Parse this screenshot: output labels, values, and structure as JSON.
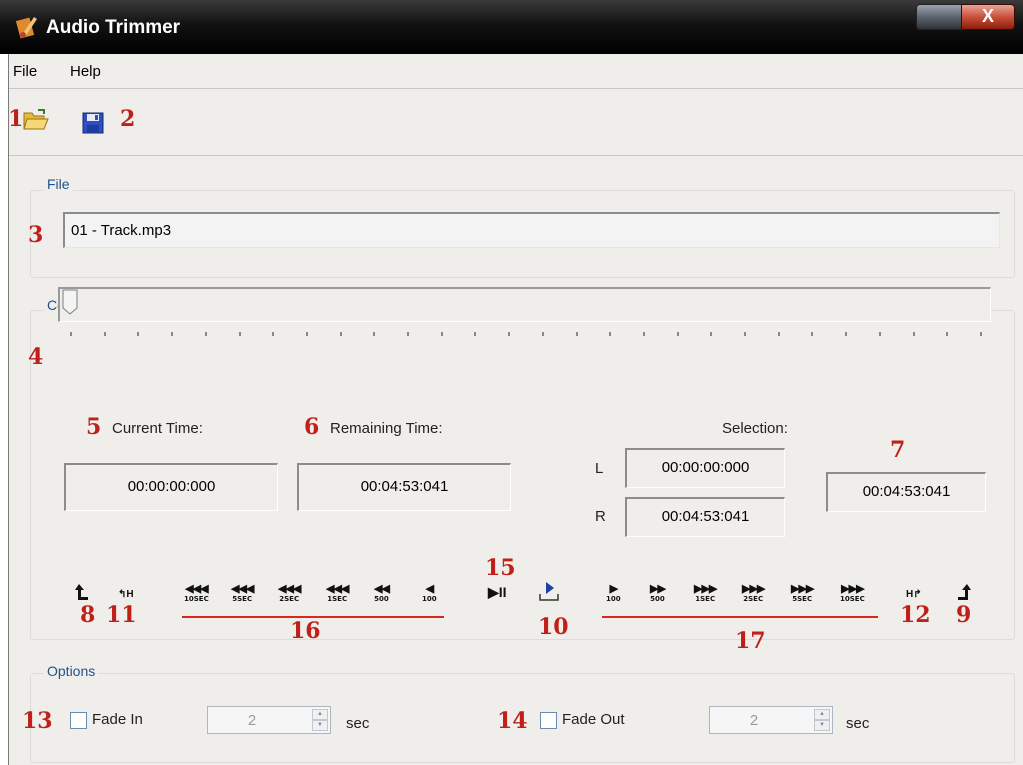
{
  "window": {
    "title": "Audio Trimmer",
    "close_glyph": "X"
  },
  "menu": {
    "file": "File",
    "help": "Help"
  },
  "toolbar": {
    "open_icon": "folder-open-icon",
    "save_icon": "floppy-save-icon"
  },
  "callouts": {
    "n1": "1",
    "n2": "2",
    "n3": "3",
    "n4": "4",
    "n5": "5",
    "n6": "6",
    "n7": "7",
    "n8": "8",
    "n9": "9",
    "n10": "10",
    "n11": "11",
    "n12": "12",
    "n13": "13",
    "n14": "14",
    "n15": "15",
    "n16": "16",
    "n17": "17"
  },
  "file_group": {
    "label": "File",
    "path": "01 - Track.mp3"
  },
  "control_group": {
    "label": "Control",
    "slider_position": 0,
    "current_time_label": "Current Time:",
    "current_time": "00:00:00:000",
    "remaining_time_label": "Remaining Time:",
    "remaining_time": "00:04:53:041",
    "selection_label": "Selection:",
    "sel_left_label": "L",
    "sel_left": "00:00:00:000",
    "sel_right_label": "R",
    "sel_right": "00:04:53:041",
    "sel_length": "00:04:53:041"
  },
  "transport": {
    "rewind": [
      {
        "arrows": "◀◀◀",
        "cap": "10SEC"
      },
      {
        "arrows": "◀◀◀",
        "cap": "5SEC"
      },
      {
        "arrows": "◀◀◀",
        "cap": "2SEC"
      },
      {
        "arrows": "◀◀◀",
        "cap": "1SEC"
      },
      {
        "arrows": "◀◀",
        "cap": "500"
      },
      {
        "arrows": "◀",
        "cap": "100"
      }
    ],
    "forward": [
      {
        "arrows": "▶",
        "cap": "100"
      },
      {
        "arrows": "▶▶",
        "cap": "500"
      },
      {
        "arrows": "▶▶▶",
        "cap": "1SEC"
      },
      {
        "arrows": "▶▶▶",
        "cap": "2SEC"
      },
      {
        "arrows": "▶▶▶",
        "cap": "5SEC"
      },
      {
        "arrows": "▶▶▶",
        "cap": "10SEC"
      }
    ],
    "play_pause": "▶II",
    "goto_start_mark": "H",
    "goto_end_mark": "H"
  },
  "options_group": {
    "label": "Options",
    "fade_in_label": "Fade In",
    "fade_in_value": "2",
    "fade_out_label": "Fade Out",
    "fade_out_value": "2",
    "unit": "sec",
    "fade_in_checked": false,
    "fade_out_checked": false
  },
  "colors": {
    "callout": "#c0201a",
    "group_label": "#22528e",
    "window_bg": "#f0eeea"
  }
}
